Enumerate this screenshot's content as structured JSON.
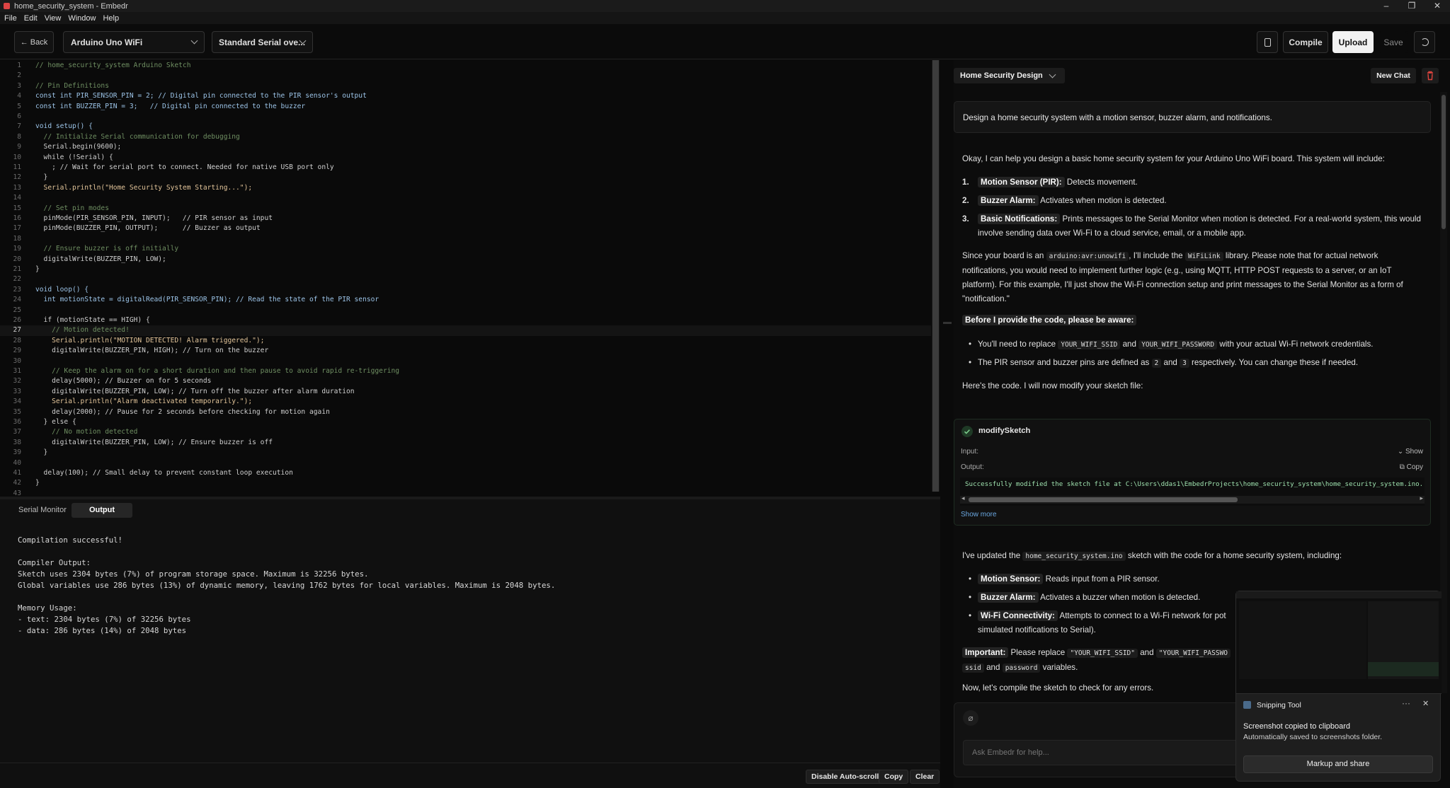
{
  "window": {
    "title": "home_security_system - Embedr"
  },
  "menu": [
    "File",
    "Edit",
    "View",
    "Window",
    "Help"
  ],
  "toolbar": {
    "back_label": "← Back",
    "board": "Arduino Uno WiFi",
    "port": "Standard Serial ove...",
    "compile_label": "Compile",
    "upload_label": "Upload",
    "save_label": "Save"
  },
  "editor": {
    "current_line": 27,
    "lines": [
      "// home_security_system Arduino Sketch",
      "",
      "// Pin Definitions",
      "const int PIR_SENSOR_PIN = 2; // Digital pin connected to the PIR sensor's output",
      "const int BUZZER_PIN = 3;   // Digital pin connected to the buzzer",
      "",
      "void setup() {",
      "  // Initialize Serial communication for debugging",
      "  Serial.begin(9600);",
      "  while (!Serial) {",
      "    ; // Wait for serial port to connect. Needed for native USB port only",
      "  }",
      "  Serial.println(\"Home Security System Starting...\");",
      "",
      "  // Set pin modes",
      "  pinMode(PIR_SENSOR_PIN, INPUT);   // PIR sensor as input",
      "  pinMode(BUZZER_PIN, OUTPUT);      // Buzzer as output",
      "",
      "  // Ensure buzzer is off initially",
      "  digitalWrite(BUZZER_PIN, LOW);",
      "}",
      "",
      "void loop() {",
      "  int motionState = digitalRead(PIR_SENSOR_PIN); // Read the state of the PIR sensor",
      "",
      "  if (motionState == HIGH) {",
      "    // Motion detected!",
      "    Serial.println(\"MOTION DETECTED! Alarm triggered.\");",
      "    digitalWrite(BUZZER_PIN, HIGH); // Turn on the buzzer",
      "",
      "    // Keep the alarm on for a short duration and then pause to avoid rapid re-triggering",
      "    delay(5000); // Buzzer on for 5 seconds",
      "    digitalWrite(BUZZER_PIN, LOW); // Turn off the buzzer after alarm duration",
      "    Serial.println(\"Alarm deactivated temporarily.\");",
      "    delay(2000); // Pause for 2 seconds before checking for motion again",
      "  } else {",
      "    // No motion detected",
      "    digitalWrite(BUZZER_PIN, LOW); // Ensure buzzer is off",
      "  }",
      "",
      "  delay(100); // Small delay to prevent constant loop execution",
      "}",
      ""
    ]
  },
  "bottom_panel": {
    "tabs": [
      "Serial Monitor",
      "Output"
    ],
    "active_tab": "Output",
    "output_lines": [
      "Compilation successful!",
      "",
      "Compiler Output:",
      "Sketch uses 2304 bytes (7%) of program storage space. Maximum is 32256 bytes.",
      "Global variables use 286 bytes (13%) of dynamic memory, leaving 1762 bytes for local variables. Maximum is 2048 bytes.",
      "",
      "Memory Usage:",
      "- text: 2304 bytes (7%) of 32256 bytes",
      "- data: 286 bytes (14%) of 2048 bytes"
    ],
    "autoscroll_label": "Disable Auto-scroll",
    "copy_label": "Copy",
    "clear_label": "Clear"
  },
  "chat": {
    "selector": "Home Security Design",
    "new_chat_label": "New Chat",
    "user_message": "Design a home security system with a motion sensor, buzzer alarm, and notifications.",
    "intro": "Okay, I can help you design a basic home security system for your Arduino Uno WiFi board. This system will include:",
    "features": [
      {
        "num": "1.",
        "title": "Motion Sensor (PIR):",
        "text": " Detects movement."
      },
      {
        "num": "2.",
        "title": "Buzzer Alarm:",
        "text": " Activates when motion is detected."
      },
      {
        "num": "3.",
        "title": "Basic Notifications:",
        "text": " Prints messages to the Serial Monitor when motion is detected. For a real-world system, this would involve sending data over Wi-Fi to a cloud service, email, or a mobile app."
      }
    ],
    "board_para": {
      "a": "Since your board is an ",
      "fqbn": "arduino:avr:unowifi",
      "b": ", I'll include the ",
      "lib": "WiFiLink",
      "c": " library. Please note that for actual network notifications, you would need to implement further logic (e.g., using MQTT, HTTP POST requests to a server, or an IoT platform). For this example, I'll just show the Wi-Fi connection setup and print messages to the Serial Monitor as a form of \"notification.\""
    },
    "aware_heading": "Before I provide the code, please be aware:",
    "aware_1": {
      "a": "You'll need to replace ",
      "ssid": "YOUR_WIFI_SSID",
      "b": " and ",
      "pass": "YOUR_WIFI_PASSWORD",
      "c": " with your actual Wi-Fi network credentials."
    },
    "aware_2": {
      "a": "The PIR sensor and buzzer pins are defined as ",
      "p1": "2",
      "b": " and ",
      "p2": "3",
      "c": " respectively. You can change these if needed."
    },
    "code_intro": "Here's the code. I will now modify your sketch file:",
    "tool": {
      "name": "modifySketch",
      "input_label": "Input:",
      "show_label": "Show",
      "output_label": "Output:",
      "copy_label": "Copy",
      "output_text": "Successfully modified the sketch file at C:\\Users\\ddas1\\EmbedrProjects\\home_security_system\\home_security_system.ino. A bac",
      "show_more": "Show more"
    },
    "updated": {
      "a": "I've updated the ",
      "file": "home_security_system.ino",
      "b": " sketch with the code for a home security system, including:"
    },
    "summary": [
      {
        "title": "Motion Sensor:",
        "text": " Reads input from a PIR sensor."
      },
      {
        "title": "Buzzer Alarm:",
        "text": " Activates a buzzer when motion is detected."
      },
      {
        "title": "Wi-Fi Connectivity:",
        "text": " Attempts to connect to a Wi-Fi network for pot"
      }
    ],
    "summary_cont": "simulated notifications to Serial).",
    "important": {
      "title": "Important:",
      "a": " Please replace ",
      "ssid": "\"YOUR_WIFI_SSID\"",
      "b": " and ",
      "pass": "\"YOUR_WIFI_PASSWO",
      "v1": "ssid",
      "c": " and ",
      "v2": "password",
      "d": " variables."
    },
    "compile_note": "Now, let's compile the sketch to check for any errors.",
    "input_placeholder": "Ask Embedr for help..."
  },
  "toast": {
    "app": "Snipping Tool",
    "line1": "Screenshot copied to clipboard",
    "line2": "Automatically saved to screenshots folder.",
    "button": "Markup and share"
  }
}
